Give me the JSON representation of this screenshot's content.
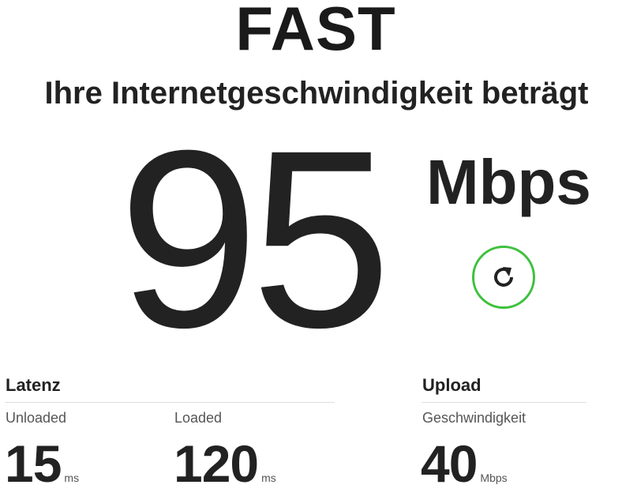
{
  "brand": {
    "logo_text": "FAST"
  },
  "headline": "Ihre Internetgeschwindigkeit beträgt",
  "speed": {
    "value": "95",
    "unit": "Mbps"
  },
  "refresh": {
    "icon": "refresh-icon",
    "color": "#3ec13e"
  },
  "latency": {
    "title": "Latenz",
    "unloaded": {
      "label": "Unloaded",
      "value": "15",
      "unit": "ms"
    },
    "loaded": {
      "label": "Loaded",
      "value": "120",
      "unit": "ms"
    }
  },
  "upload": {
    "title": "Upload",
    "speed": {
      "label": "Geschwindigkeit",
      "value": "40",
      "unit": "Mbps"
    }
  }
}
